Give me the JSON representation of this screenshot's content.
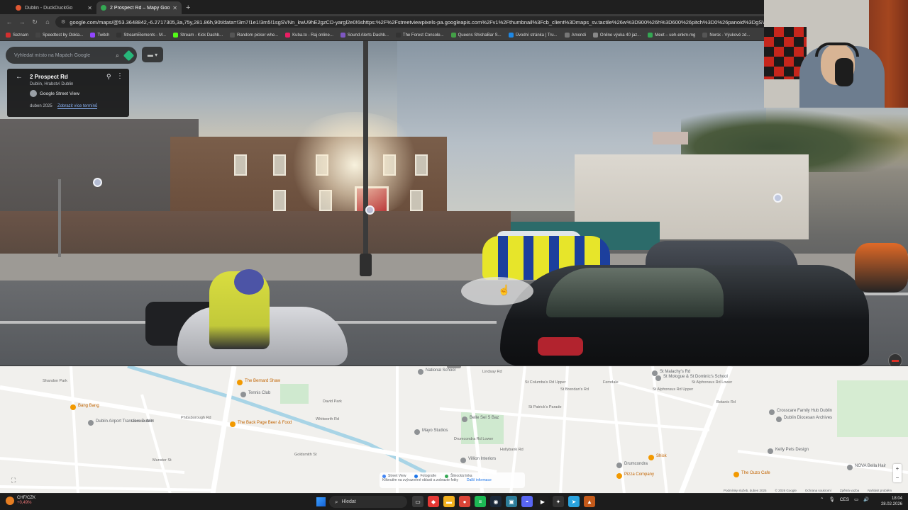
{
  "browser": {
    "tabs": [
      {
        "title": "Dublin - DuckDuckGo",
        "active": false,
        "favicon_color": "#de5833"
      },
      {
        "title": "2 Prospect Rd – Mapy Google",
        "active": true,
        "favicon_color": "#34a853"
      }
    ],
    "url": "google.com/maps/@53.3648842,-6.2717305,3a,75y,281.86h,90t/data=!3m7!1e1!3m5!1sgSVNn_kwU9hE2gzCD-yargl2e0!6shttps:%2F%2Fstreetviewpixels-pa.googleapis.com%2Fv1%2Fthumbnail%3Fcb_client%3Dmaps_sv.tactile%26w%3D900%26h%3D600%26pitch%3D0%26panoid%3DgSVNn_kwU9hE2gzCD-yarg%26y",
    "bookmarks": [
      {
        "label": "Seznam",
        "color": "#d32f2f"
      },
      {
        "label": "Speedtest by Ookla...",
        "color": "#444"
      },
      {
        "label": "Twitch",
        "color": "#9146ff"
      },
      {
        "label": "StreamElements - M...",
        "color": "#333"
      },
      {
        "label": "Stream - Kick Dashb...",
        "color": "#53fc18"
      },
      {
        "label": "Random picker whe...",
        "color": "#555"
      },
      {
        "label": "Kuba.to - Raj online...",
        "color": "#e91e63"
      },
      {
        "label": "Sound Alerts Dashb...",
        "color": "#7e57c2"
      },
      {
        "label": "The Forest Console...",
        "color": "#333"
      },
      {
        "label": "Queens ShishaBar S...",
        "color": "#43a047"
      },
      {
        "label": "Úvodní stránka | Tru...",
        "color": "#1e88e5"
      },
      {
        "label": "Amondi",
        "color": "#777"
      },
      {
        "label": "Online výuka 40 jaz...",
        "color": "#888"
      },
      {
        "label": "Meet – ueh-enkm-mg",
        "color": "#34a853"
      },
      {
        "label": "Norsk - Výukové zd...",
        "color": "#555"
      }
    ]
  },
  "streetview": {
    "search_placeholder": "Vyhledat místo na Mapách Google",
    "card": {
      "title": "2 Prospect Rd",
      "subtitle": "Dublin, Hrabství Dublin",
      "source": "Google Street View",
      "date": "duben 2025",
      "more_dates": "Zobrazit více termínů"
    },
    "zoom_in": "+",
    "zoom_out": "−"
  },
  "map": {
    "labels": [
      {
        "text": "Shandon Park"
      },
      {
        "text": "The Bernard Shaw"
      },
      {
        "text": "Bang Bang"
      },
      {
        "text": "Tennis Club"
      },
      {
        "text": "Leinster St N"
      },
      {
        "text": "Phibsborough Rd"
      },
      {
        "text": "Dublin Airport Transfers Dublin"
      },
      {
        "text": "The Back Page Beer & Food"
      },
      {
        "text": "Whitworth Rd"
      },
      {
        "text": "David Park"
      },
      {
        "text": "Munster St"
      },
      {
        "text": "Goldsmith St"
      },
      {
        "text": "Drumcondra Rd Lower"
      },
      {
        "text": "National School"
      },
      {
        "text": "Lindsay Rd"
      },
      {
        "text": "Belle Sel S Baz"
      },
      {
        "text": "Mayo Studios"
      },
      {
        "text": "St Patrick's Parade"
      },
      {
        "text": "St Brendan's Rd"
      },
      {
        "text": "St Columba's Rd Upper"
      },
      {
        "text": "Hollybank Rd"
      },
      {
        "text": "Villion Interiors"
      },
      {
        "text": "St Alphonsus Rd Upper"
      },
      {
        "text": "St Malachy's Rd"
      },
      {
        "text": "St Mologue & St Dominic's School"
      },
      {
        "text": "Ferndale"
      },
      {
        "text": "Dublin Diocesan Archives"
      },
      {
        "text": "Crosscare Family Hub Dublin"
      },
      {
        "text": "Kelly Pets Design"
      },
      {
        "text": "Shisk"
      },
      {
        "text": "Drumcondra"
      },
      {
        "text": "NOVA Bella Hair"
      },
      {
        "text": "The Ouzo Cafe"
      },
      {
        "text": "Pizza Company"
      },
      {
        "text": "St Alphonsus Rd Lower"
      },
      {
        "text": "Botanic Rd"
      }
    ],
    "legend": {
      "street_view": "Street View",
      "photos": "Fotografie",
      "lines": "Šlinocká linka",
      "note": "Kliknutím na zvýrazněné oblasti a zobrazte fotky",
      "link": "Další informace"
    },
    "footer": [
      "Podmínky služeb, duben 2025",
      "© 2026 Google",
      "Ochrana soukromí",
      "Zpětná vazba",
      "Nahlásit problém"
    ]
  },
  "taskbar": {
    "ticker": "CHF/CZK",
    "ticker_change": "+0,49%",
    "search_label": "Hledat",
    "apps": [
      {
        "icon": "explorer-icon",
        "color": "#3a3a3a",
        "glyph": "▭"
      },
      {
        "icon": "app-red-icon",
        "color": "#e53935",
        "glyph": "◆"
      },
      {
        "icon": "folder-icon",
        "color": "#f2b01e",
        "glyph": "▬"
      },
      {
        "icon": "chrome-icon",
        "color": "#db4437",
        "glyph": "●"
      },
      {
        "icon": "spotify-icon",
        "color": "#1db954",
        "glyph": "≡"
      },
      {
        "icon": "steam-icon",
        "color": "#1b2838",
        "glyph": "◉"
      },
      {
        "icon": "window-icon",
        "color": "#2d7d9a",
        "glyph": "▣"
      },
      {
        "icon": "discord-icon",
        "color": "#5865f2",
        "glyph": "◓"
      },
      {
        "icon": "terminal-icon",
        "color": "#1e1e1e",
        "glyph": "▶"
      },
      {
        "icon": "game-icon",
        "color": "#333333",
        "glyph": "✦"
      },
      {
        "icon": "telegram-icon",
        "color": "#2aa3df",
        "glyph": "➤"
      },
      {
        "icon": "app-orange-icon",
        "color": "#c45a1a",
        "glyph": "▲"
      }
    ],
    "lang": "CES",
    "time": "18:04",
    "date": "28.02.2026"
  }
}
